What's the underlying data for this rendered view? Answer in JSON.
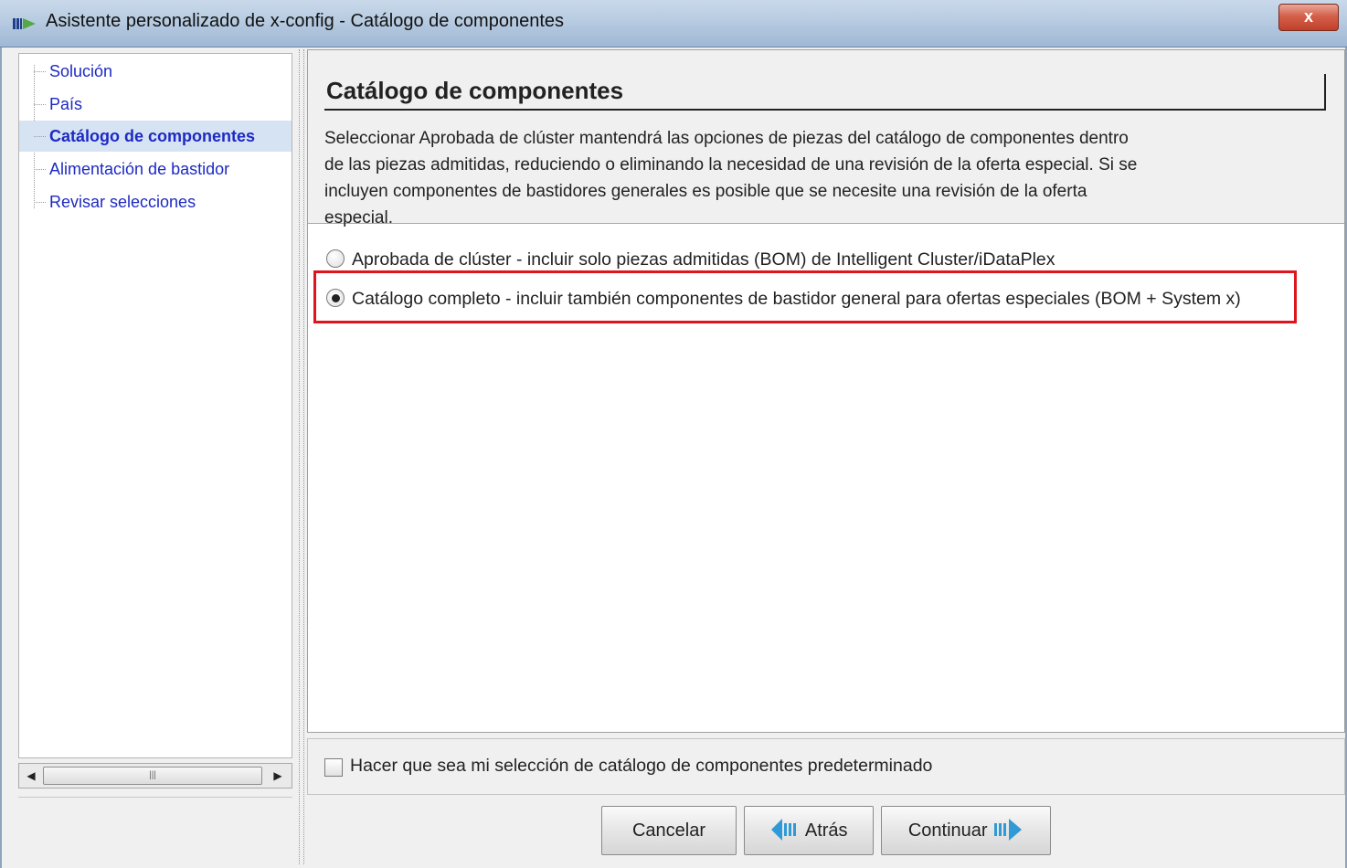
{
  "window": {
    "title": "Asistente personalizado de x-config - Catálogo de componentes",
    "close_label": "x"
  },
  "nav": {
    "items": [
      {
        "label": "Solución",
        "selected": false
      },
      {
        "label": "País",
        "selected": false
      },
      {
        "label": "Catálogo de componentes",
        "selected": true
      },
      {
        "label": "Alimentación de bastidor",
        "selected": false
      },
      {
        "label": "Revisar selecciones",
        "selected": false
      }
    ],
    "scroll_thumb_glyph": "|||"
  },
  "main": {
    "page_title": "Catálogo de componentes",
    "description": "Seleccionar Aprobada de clúster mantendrá las opciones de piezas del catálogo de componentes dentro de las piezas admitidas, reduciendo o eliminando la necesidad de una revisión de la oferta especial. Si se incluyen componentes de bastidores generales es posible que se necesite una revisión de la oferta especial.",
    "options": [
      {
        "label": "Aprobada de clúster - incluir solo piezas admitidas (BOM) de Intelligent Cluster/iDataPlex",
        "checked": false
      },
      {
        "label": "Catálogo completo - incluir también componentes de bastidor general para ofertas especiales (BOM + System x)",
        "checked": true
      }
    ],
    "highlight_color": "#e0141c"
  },
  "footer": {
    "default_checkbox_label": "Hacer que sea mi selección de catálogo de componentes predeterminado",
    "default_checked": false,
    "buttons": {
      "cancel": "Cancelar",
      "back": "Atrás",
      "continue": "Continuar"
    }
  },
  "colors": {
    "link_blue": "#1d2ac4",
    "selected_bg": "#d6e3f3",
    "arrow_blue": "#2f9ad6"
  }
}
